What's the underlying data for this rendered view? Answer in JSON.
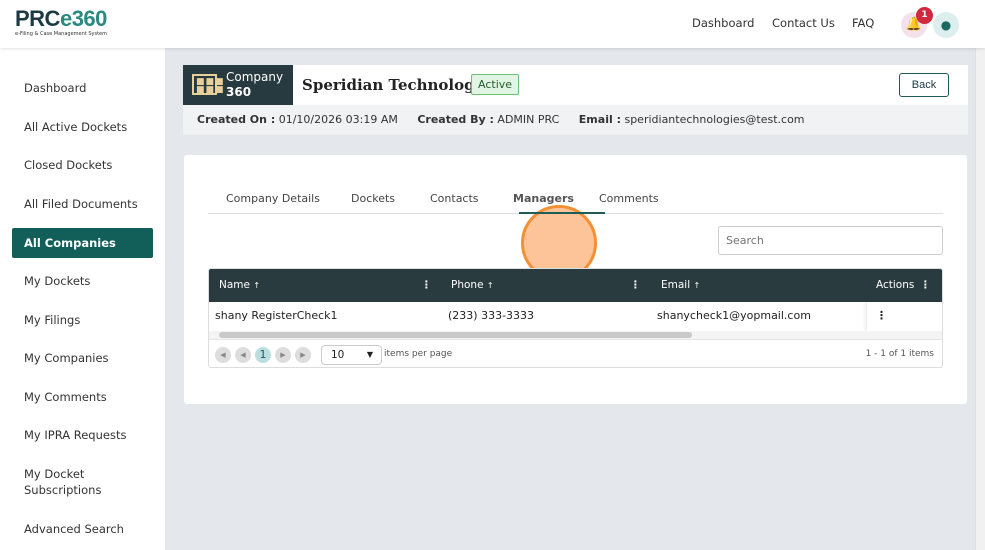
{
  "brand": {
    "name_a": "PRC",
    "name_b": "e360",
    "tagline": "e-Filing & Case Management System"
  },
  "topnav": {
    "links": [
      "Dashboard",
      "Contact Us",
      "FAQ"
    ],
    "notification_count": "1"
  },
  "sidebar": {
    "items": [
      "Dashboard",
      "All Active Dockets",
      "Closed Dockets",
      "All Filed Documents",
      "All Companies",
      "My Dockets",
      "My Filings",
      "My Companies",
      "My Comments",
      "My IPRA Requests",
      "My Docket Subscriptions",
      "Advanced Search"
    ],
    "active": "All Companies"
  },
  "company": {
    "label1": "Company",
    "label2": "360",
    "name": "Speridian Technologies",
    "status": "Active",
    "back": "Back",
    "created_on_label": "Created On :",
    "created_on": "01/10/2026 03:19 AM",
    "created_by_label": "Created By :",
    "created_by": "ADMIN PRC",
    "email_label": "Email :",
    "email": "speridiantechnologies@test.com"
  },
  "tabs": [
    "Company Details",
    "Dockets",
    "Contacts",
    "Managers",
    "Comments"
  ],
  "active_tab": "Managers",
  "search": {
    "placeholder": "Search"
  },
  "table": {
    "columns": [
      "Name",
      "Phone",
      "Email",
      "Actions"
    ],
    "rows": [
      {
        "name": "shany RegisterCheck1",
        "phone": "(233) 333-3333",
        "email": "shanycheck1@yopmail.com"
      }
    ]
  },
  "pager": {
    "page": "1",
    "page_size": "10",
    "per_page_label": "items per page",
    "summary": "1 - 1 of 1 items"
  }
}
